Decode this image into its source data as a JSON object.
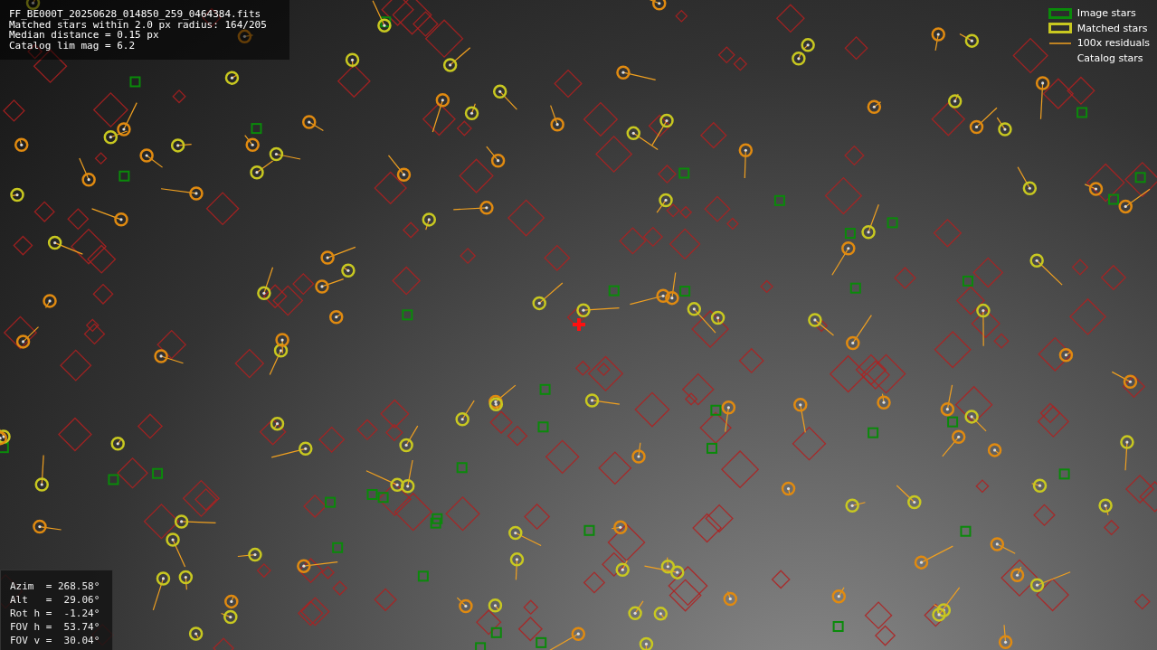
{
  "header": {
    "lines": [
      "FF_BE000T_20250628_014850_259_0464384.fits",
      "Matched stars within 2.0 px radius: 164/205",
      "Median distance = 0.15 px",
      "Catalog lim mag = 6.2"
    ]
  },
  "legend": [
    {
      "kind": "image",
      "label": "Image stars"
    },
    {
      "kind": "matched",
      "label": "Matched stars"
    },
    {
      "kind": "residual",
      "label": "100x residuals"
    },
    {
      "kind": "catalog",
      "label": "Catalog stars"
    }
  ],
  "pointing": [
    {
      "label": "Azim  =",
      "value": "268.58°"
    },
    {
      "label": "Alt   =",
      "value": " 29.06°"
    },
    {
      "label": "Rot h =",
      "value": " -1.24°"
    },
    {
      "label": "FOV h =",
      "value": " 53.74°"
    },
    {
      "label": "FOV v =",
      "value": " 30.04°"
    }
  ]
}
